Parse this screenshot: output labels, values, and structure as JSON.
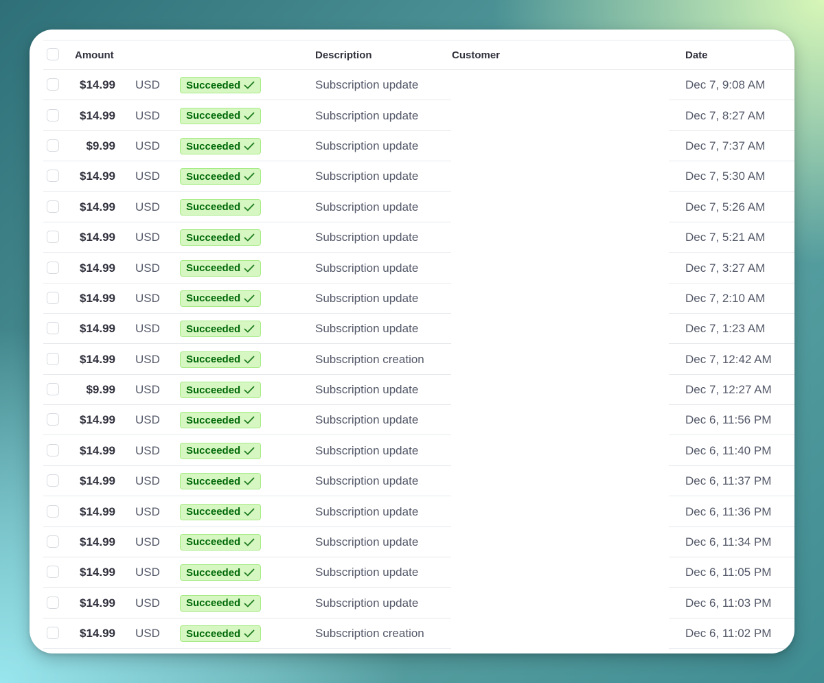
{
  "table": {
    "headers": {
      "amount": "Amount",
      "description": "Description",
      "customer": "Customer",
      "date": "Date"
    },
    "rows": [
      {
        "amount": "$14.99",
        "currency": "USD",
        "status": "Succeeded",
        "description": "Subscription update",
        "customer": "",
        "date": "Dec 7, 9:08 AM"
      },
      {
        "amount": "$14.99",
        "currency": "USD",
        "status": "Succeeded",
        "description": "Subscription update",
        "customer": "",
        "date": "Dec 7, 8:27 AM"
      },
      {
        "amount": "$9.99",
        "currency": "USD",
        "status": "Succeeded",
        "description": "Subscription update",
        "customer": "",
        "date": "Dec 7, 7:37 AM"
      },
      {
        "amount": "$14.99",
        "currency": "USD",
        "status": "Succeeded",
        "description": "Subscription update",
        "customer": "",
        "date": "Dec 7, 5:30 AM"
      },
      {
        "amount": "$14.99",
        "currency": "USD",
        "status": "Succeeded",
        "description": "Subscription update",
        "customer": "",
        "date": "Dec 7, 5:26 AM"
      },
      {
        "amount": "$14.99",
        "currency": "USD",
        "status": "Succeeded",
        "description": "Subscription update",
        "customer": "",
        "date": "Dec 7, 5:21 AM"
      },
      {
        "amount": "$14.99",
        "currency": "USD",
        "status": "Succeeded",
        "description": "Subscription update",
        "customer": "",
        "date": "Dec 7, 3:27 AM"
      },
      {
        "amount": "$14.99",
        "currency": "USD",
        "status": "Succeeded",
        "description": "Subscription update",
        "customer": "",
        "date": "Dec 7, 2:10 AM"
      },
      {
        "amount": "$14.99",
        "currency": "USD",
        "status": "Succeeded",
        "description": "Subscription update",
        "customer": "",
        "date": "Dec 7, 1:23 AM"
      },
      {
        "amount": "$14.99",
        "currency": "USD",
        "status": "Succeeded",
        "description": "Subscription creation",
        "customer": "",
        "date": "Dec 7, 12:42 AM"
      },
      {
        "amount": "$9.99",
        "currency": "USD",
        "status": "Succeeded",
        "description": "Subscription update",
        "customer": "",
        "date": "Dec 7, 12:27 AM"
      },
      {
        "amount": "$14.99",
        "currency": "USD",
        "status": "Succeeded",
        "description": "Subscription update",
        "customer": "",
        "date": "Dec 6, 11:56 PM"
      },
      {
        "amount": "$14.99",
        "currency": "USD",
        "status": "Succeeded",
        "description": "Subscription update",
        "customer": "",
        "date": "Dec 6, 11:40 PM"
      },
      {
        "amount": "$14.99",
        "currency": "USD",
        "status": "Succeeded",
        "description": "Subscription update",
        "customer": "",
        "date": "Dec 6, 11:37 PM"
      },
      {
        "amount": "$14.99",
        "currency": "USD",
        "status": "Succeeded",
        "description": "Subscription update",
        "customer": "",
        "date": "Dec 6, 11:36 PM"
      },
      {
        "amount": "$14.99",
        "currency": "USD",
        "status": "Succeeded",
        "description": "Subscription update",
        "customer": "",
        "date": "Dec 6, 11:34 PM"
      },
      {
        "amount": "$14.99",
        "currency": "USD",
        "status": "Succeeded",
        "description": "Subscription update",
        "customer": "",
        "date": "Dec 6, 11:05 PM"
      },
      {
        "amount": "$14.99",
        "currency": "USD",
        "status": "Succeeded",
        "description": "Subscription update",
        "customer": "",
        "date": "Dec 6, 11:03 PM"
      },
      {
        "amount": "$14.99",
        "currency": "USD",
        "status": "Succeeded",
        "description": "Subscription creation",
        "customer": "",
        "date": "Dec 6, 11:02 PM"
      }
    ]
  },
  "status_icon": "checkmark-icon",
  "colors": {
    "badge_background": "#d7f7c2",
    "badge_border": "#a6eb84",
    "badge_text": "#006908",
    "primary_text": "#30313d",
    "secondary_text": "#545969"
  }
}
